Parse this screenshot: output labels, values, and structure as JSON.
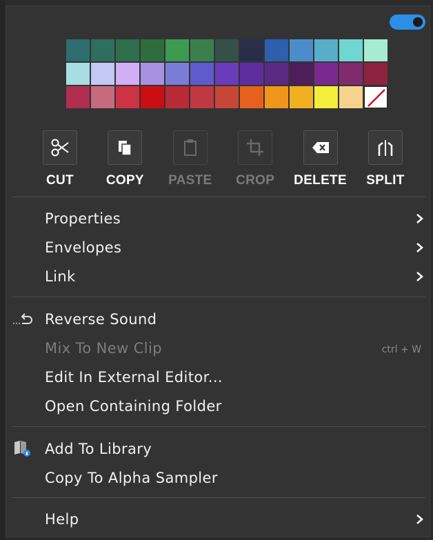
{
  "toggle": {
    "on": true,
    "color": "#2d8ee8"
  },
  "palette": [
    "#2e6e6e",
    "#2e6e5e",
    "#2e6e4c",
    "#2e6e3e",
    "#3e9a50",
    "#3b7f4f",
    "#345048",
    "#2a2d4a",
    "#2e5fae",
    "#4a8ccc",
    "#58aec8",
    "#70d6d2",
    "#a6ecd2",
    "#a8dee2",
    "#c4c8f4",
    "#d2aef4",
    "#a890e2",
    "#7a7cd8",
    "#5e5ccc",
    "#6a3cbc",
    "#5e2ea0",
    "#5a2a82",
    "#4e1e5a",
    "#7a2a8e",
    "#822a6e",
    "#8e2240",
    "#b02e50",
    "#c86a7e",
    "#cc3444",
    "#cc0e14",
    "#b82a36",
    "#c03842",
    "#c84636",
    "#e8601e",
    "#f0961c",
    "#f2b020",
    "#f2ee3a",
    "#f6d38c",
    "none"
  ],
  "tools": [
    {
      "label": "CUT",
      "icon": "scissors-icon",
      "enabled": true
    },
    {
      "label": "COPY",
      "icon": "copy-icon",
      "enabled": true
    },
    {
      "label": "PASTE",
      "icon": "paste-icon",
      "enabled": false
    },
    {
      "label": "CROP",
      "icon": "crop-icon",
      "enabled": false
    },
    {
      "label": "DELETE",
      "icon": "delete-icon",
      "enabled": true
    },
    {
      "label": "SPLIT",
      "icon": "split-icon",
      "enabled": true
    }
  ],
  "menu": {
    "properties": "Properties",
    "envelopes": "Envelopes",
    "link": "Link",
    "reverse_sound": "Reverse Sound",
    "mix_to_new_clip": "Mix To New Clip",
    "mix_shortcut": "ctrl + W",
    "edit_external": "Edit In External Editor...",
    "open_folder": "Open Containing Folder",
    "add_library": "Add To Library",
    "copy_alpha": "Copy To Alpha Sampler",
    "help": "Help"
  }
}
